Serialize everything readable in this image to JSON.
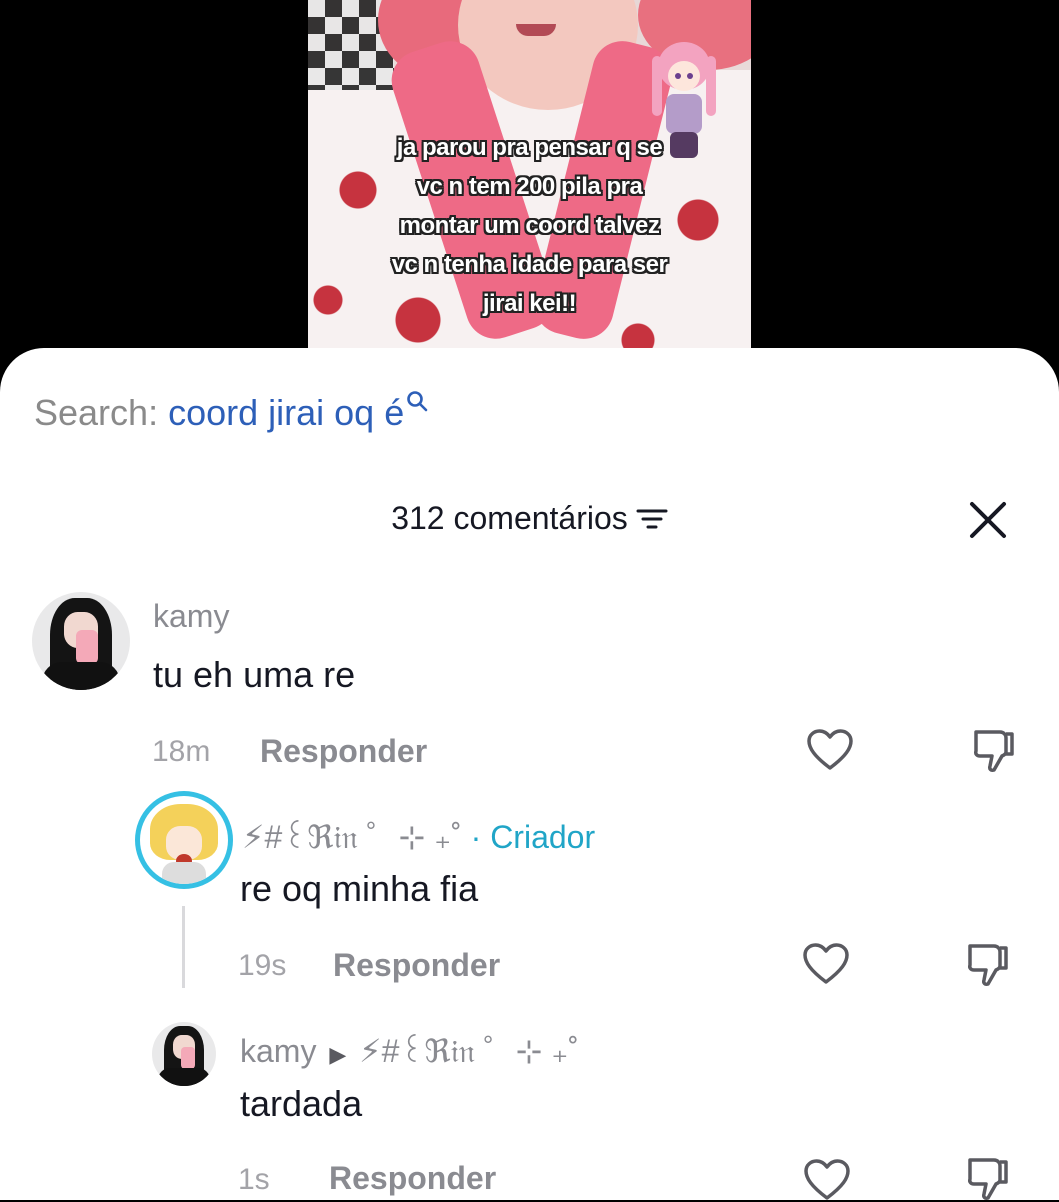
{
  "video": {
    "caption_lines": [
      "ja parou pra pensar q se",
      "vc n tem 200 pila pra",
      "montar um coord talvez",
      "vc n tenha idade para ser",
      "jirai kei!!"
    ]
  },
  "search": {
    "prefix": "Search:",
    "query": "coord jirai oq é"
  },
  "header": {
    "title": "312 comentários"
  },
  "comments": [
    {
      "user": "kamy",
      "text": "tu eh uma re",
      "time": "18m",
      "reply": "Responder"
    },
    {
      "user": "⚡#꒰ℜ𝔦𝔫 ゜⊹ ₊˚",
      "badge": "· Criador",
      "text": "re oq minha fia",
      "time": "19s",
      "reply": "Responder"
    },
    {
      "user": "kamy",
      "reply_to": "⚡#꒰ℜ𝔦𝔫 ゜⊹ ₊˚",
      "text": "tardada",
      "time": "1s",
      "reply": "Responder"
    }
  ],
  "colors": {
    "accent_search": "#2d5fb8",
    "creator_badge": "#20a5c7",
    "creator_ring": "#35c0e4"
  }
}
